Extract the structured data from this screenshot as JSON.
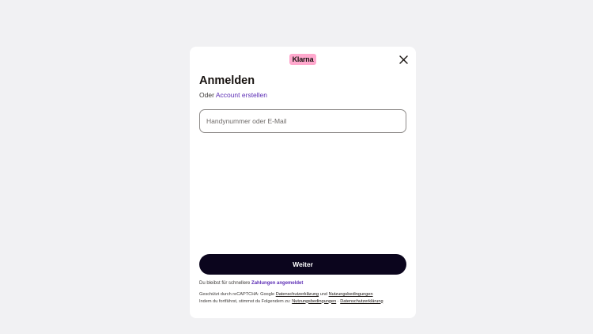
{
  "modal": {
    "logo_text": "Klarna",
    "logo_color": "#ffa8cd",
    "close_icon": "close-icon",
    "title": "Anmelden",
    "subtitle_prefix": "Oder",
    "subtitle_link": "Account erstellen",
    "input_placeholder": "Handynummer oder E-Mail",
    "input_value": "",
    "button_label": "Weiter",
    "stay_prefix": "Du bleibst für schnellere",
    "stay_link": "Zahlungen angemeldet",
    "legal_line1_prefix": "Geschützt durch reCAPTCHA: Google",
    "legal_line1_link1": "Datenschutzerklärung",
    "legal_line1_and": "und",
    "legal_line1_link2": "Nutzungsbedingungen",
    "legal_line2_prefix": "Indem du fortfährst, stimmst du Folgendem zu:",
    "legal_line2_link1": "Nutzungsbedingungen",
    "legal_line2_sep": "·",
    "legal_line2_link2": "Datenschutzerklärung",
    "accent_color": "#5c2db5",
    "button_color": "#0b051d"
  }
}
